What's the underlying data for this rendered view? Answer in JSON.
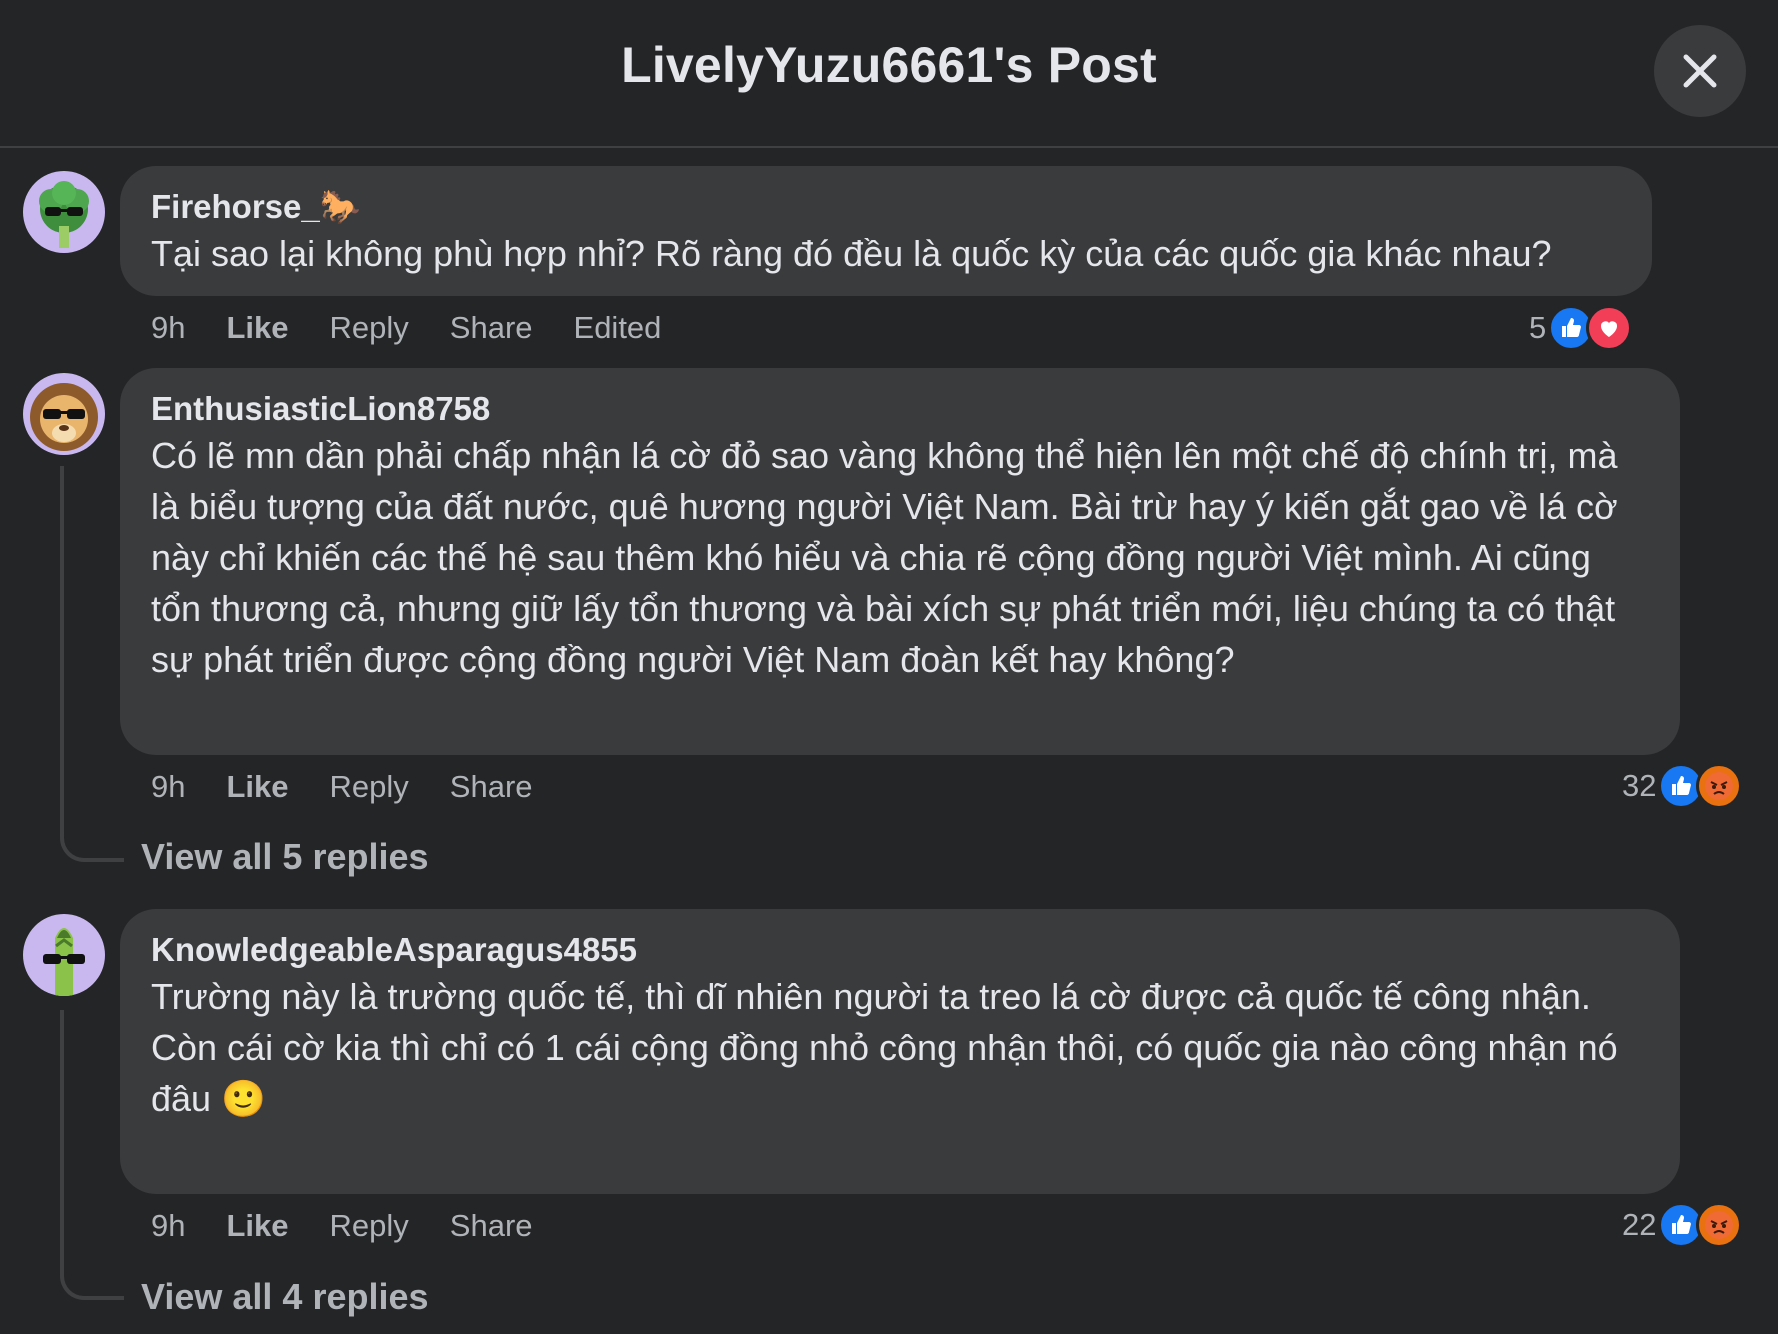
{
  "header": {
    "title": "LivelyYuzu6661's Post",
    "close_icon": "close-icon"
  },
  "comments": [
    {
      "author": "Firehorse_🐎",
      "text": "Tại sao lại không phù hợp nhỉ? Rõ ràng đó đều là quốc kỳ của các quốc gia khác nhau?",
      "time": "9h",
      "like": "Like",
      "reply": "Reply",
      "share": "Share",
      "edited": "Edited",
      "reaction_count": "5",
      "reactions": [
        "like",
        "love"
      ],
      "avatar": "broccoli-sunglasses-avatar"
    },
    {
      "author": "EnthusiasticLion8758",
      "text": "Có lẽ mn dần phải chấp nhận lá cờ đỏ sao vàng không thể hiện lên một chế độ chính trị, mà là biểu tượng của đất nước, quê hương người Việt Nam. Bài trừ hay ý kiến gắt gao về lá cờ này chỉ khiến các thế hệ sau thêm khó hiểu và chia rẽ cộng đồng người Việt mình. Ai cũng tổn thương cả, nhưng giữ lấy tổn thương và bài xích sự phát triển mới, liệu chúng ta có thật sự phát triển được cộng đồng người Việt Nam đoàn kết hay không?",
      "time": "9h",
      "like": "Like",
      "reply": "Reply",
      "share": "Share",
      "reaction_count": "32",
      "reactions": [
        "like",
        "angry"
      ],
      "view_replies": "View all 5 replies",
      "avatar": "lion-sunglasses-avatar"
    },
    {
      "author": "KnowledgeableAsparagus4855",
      "text": "Trường này là trường quốc tế, thì dĩ nhiên người ta treo lá cờ được cả quốc tế công nhận.\nCòn cái cờ kia thì chỉ có 1 cái cộng đồng nhỏ công nhận thôi, có quốc gia nào công nhận nó đâu 🙂",
      "time": "9h",
      "like": "Like",
      "reply": "Reply",
      "share": "Share",
      "reaction_count": "22",
      "reactions": [
        "like",
        "angry"
      ],
      "view_replies": "View all 4 replies",
      "avatar": "asparagus-sunglasses-avatar"
    }
  ],
  "colors": {
    "background": "#242526",
    "bubble": "#3a3b3c",
    "text": "#e4e6eb",
    "secondary_text": "#b0b3b8",
    "like_blue": "#1877f2",
    "love_red": "#f33e58",
    "angry_orange": "#e9710f"
  }
}
